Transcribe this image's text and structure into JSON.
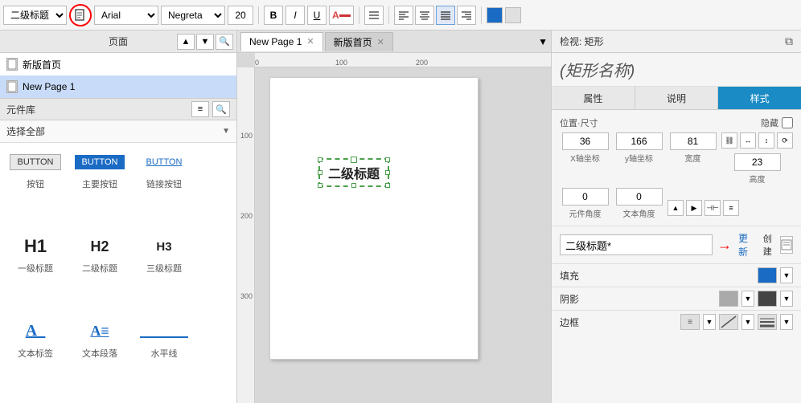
{
  "toolbar": {
    "style_select": "二级标题",
    "font_family": "Arial",
    "font_variant": "Negreta",
    "font_size": "20",
    "bold_label": "B",
    "italic_label": "I",
    "underline_label": "U",
    "font_color": "A",
    "list_icon": "≡",
    "align_left": "≡",
    "align_center": "≡",
    "align_right": "≡",
    "align_justify": "≡",
    "color_swatch": "#1a6bc4",
    "swatch2": "#cccccc"
  },
  "left_panel": {
    "pages_header": "页面",
    "pages": [
      {
        "name": "新版首页",
        "active": false
      },
      {
        "name": "New Page 1",
        "active": true
      }
    ],
    "components_header": "元件库",
    "select_all": "选择全部",
    "components": [
      {
        "type": "btn-gray",
        "label": "按钮",
        "preview": "BUTTON"
      },
      {
        "type": "btn-blue",
        "label": "主要按钮",
        "preview": "BUTTON"
      },
      {
        "type": "btn-link",
        "label": "链接按钮",
        "preview": "BUTTON"
      },
      {
        "type": "h1",
        "label": "一级标题",
        "preview": "H1"
      },
      {
        "type": "h2",
        "label": "二级标题",
        "preview": "H2"
      },
      {
        "type": "h3",
        "label": "三级标题",
        "preview": "H3"
      },
      {
        "type": "text-a",
        "label": "文本标签",
        "preview": "A_"
      },
      {
        "type": "text-b",
        "label": "文本段落",
        "preview": "A≡"
      },
      {
        "type": "line",
        "label": "水平线",
        "preview": "—"
      }
    ]
  },
  "tabs": [
    {
      "label": "New Page 1",
      "active": true,
      "closable": true
    },
    {
      "label": "新版首页",
      "active": false,
      "closable": true
    }
  ],
  "canvas": {
    "element_text": "二级标题",
    "ruler_marks_h": [
      "0",
      "100",
      "200"
    ],
    "ruler_marks_v": [
      "100",
      "200",
      "300"
    ]
  },
  "right_panel": {
    "header_title": "检视: 矩形",
    "shape_name_placeholder": "(矩形名称)",
    "tabs": [
      {
        "label": "属性",
        "active": false
      },
      {
        "label": "说明",
        "active": false
      },
      {
        "label": "样式",
        "active": true
      }
    ],
    "position_section_label": "位置·尺寸",
    "hide_label": "隐藏",
    "fields": {
      "x": "36",
      "y": "166",
      "w": "81",
      "h": "23",
      "x_label": "X轴坐标",
      "y_label": "y轴坐标",
      "w_label": "宽度",
      "h_label": "高度",
      "angle": "0",
      "text_angle": "0",
      "angle_label": "元件角度",
      "text_angle_label": "文本角度"
    },
    "style_name": "二级标题*",
    "update_label": "更新",
    "create_label": "创建",
    "fill_label": "填充",
    "shadow_label": "阴影",
    "border_label": "边框",
    "fill_color": "#1a6bc4",
    "shadow_color1": "#aaaaaa",
    "shadow_color2": "#444444",
    "border_style": "≡"
  }
}
